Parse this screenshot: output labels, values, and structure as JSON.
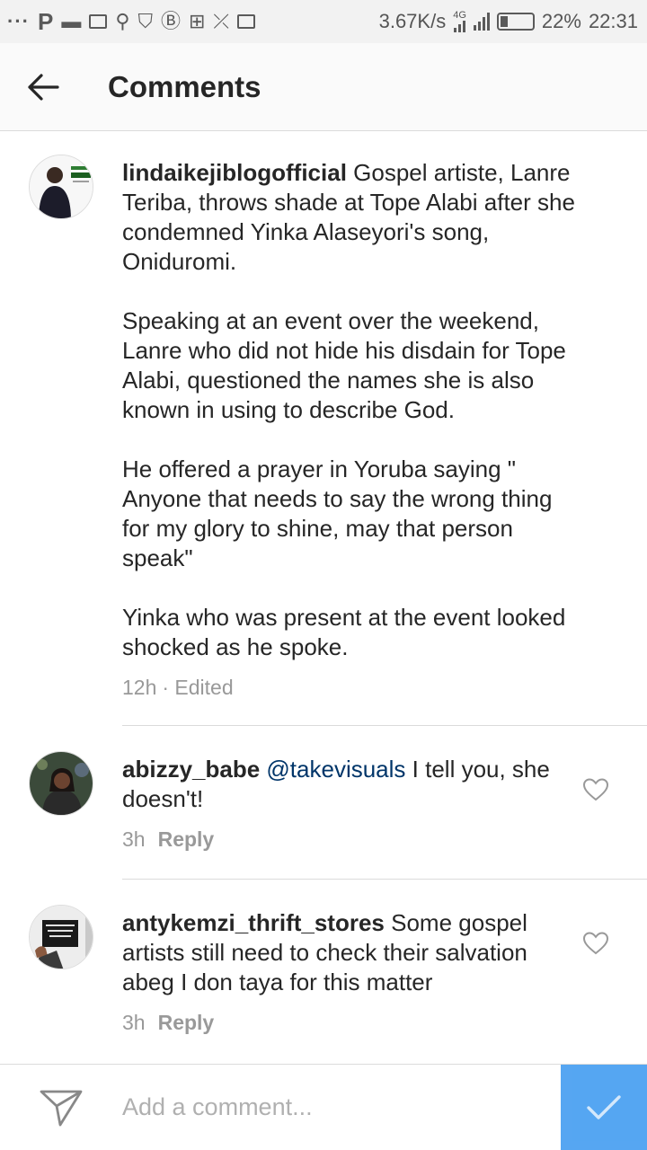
{
  "status_bar": {
    "network_speed": "3.67K/s",
    "network_type": "4G",
    "battery": "22%",
    "time": "22:31"
  },
  "header": {
    "title": "Comments"
  },
  "caption": {
    "username": "lindaikejiblogofficial",
    "paragraphs": [
      "Gospel artiste, Lanre Teriba, throws shade at Tope Alabi after she condemned Yinka Alaseyori's song, Oniduromi.",
      "Speaking at an event over the weekend, Lanre who did not hide his disdain for Tope Alabi, questioned the names she is also known in using to describe God.",
      "He offered a prayer in Yoruba saying \" Anyone that needs to say the wrong thing for my glory to shine, may that person speak\"",
      "Yinka who was present at the event looked shocked as he spoke."
    ],
    "time": "12h",
    "edited": "· Edited"
  },
  "comments": [
    {
      "username": "abizzy_babe",
      "mention": "@takevisuals",
      "text": "I tell you, she doesn't!",
      "time": "3h",
      "reply_label": "Reply"
    },
    {
      "username": "antykemzi_thrift_stores",
      "mention": "",
      "text": "Some gospel artists still need to check their salvation abeg I don taya for this matter",
      "time": "3h",
      "reply_label": "Reply"
    }
  ],
  "composer": {
    "placeholder": "Add a comment..."
  },
  "colors": {
    "accent": "#3897f0",
    "mention": "#003569",
    "muted": "#999999"
  }
}
